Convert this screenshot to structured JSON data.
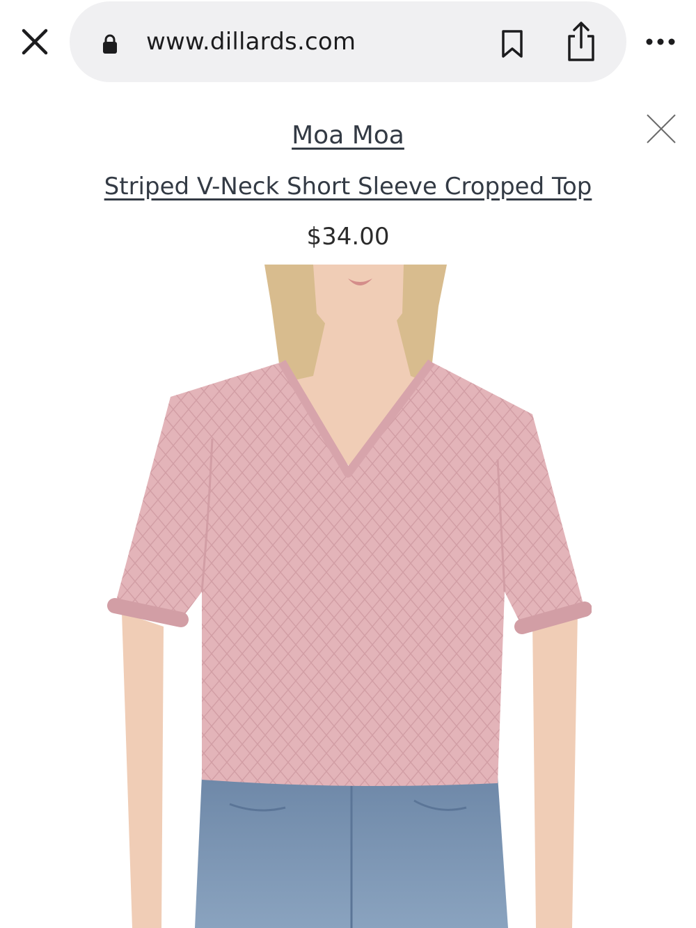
{
  "browser": {
    "url": "www.dillards.com",
    "icons": {
      "close": "close-icon",
      "lock": "lock-icon",
      "bookmark": "bookmark-icon",
      "share": "share-icon",
      "more": "more-icon"
    }
  },
  "product": {
    "brand": "Moa Moa",
    "title": "Striped V-Neck Short Sleeve Cropped Top",
    "price": "$34.00",
    "image_icon": "product-photo"
  },
  "colors": {
    "url_pill": "#f0f0f2",
    "link_text": "#333a44",
    "shirt": "#e3b4b9",
    "jeans": "#7d97b5",
    "hair": "#d8bc8e",
    "skin": "#f0cdb6"
  }
}
